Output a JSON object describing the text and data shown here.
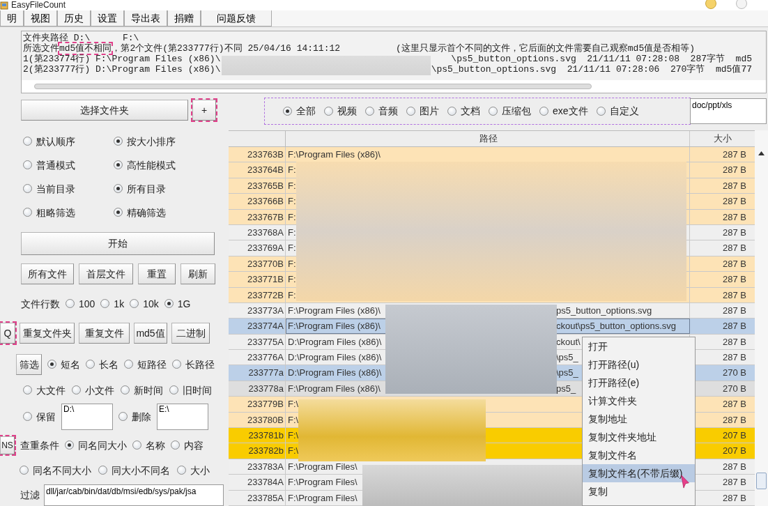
{
  "window": {
    "title": "EasyFileCount"
  },
  "menu": [
    "明",
    "视图",
    "历史",
    "设置",
    "导出表",
    "捐赠",
    "问题反馈"
  ],
  "log": {
    "folder_line": "文件夹路径 D:\\      F:\\",
    "summary_parts": [
      {
        "text": "所选文件",
        "highlighted": false
      },
      {
        "text": "md5值不相同",
        "highlighted": true
      },
      {
        "text": "，第2个文件(第233777行)不同 25/04/16 14:11:12",
        "highlighted": false
      }
    ],
    "note": "(这里只显示首个不同的文件，它后面的文件需要自己观察md5值是否相等)",
    "files": [
      {
        "head": "1(第233774行) F:\\Program Files (x86)\\",
        "tail": "\\ps5_button_options.svg  21/11/11 07:28:08  287字节  md5"
      },
      {
        "head": "2(第233777行) D:\\Program Files (x86)\\",
        "tail": "\\ps5_button_options.svg  21/11/11 07:28:06  270字节  md5值77"
      }
    ]
  },
  "select_folder_button": "选择文件夹",
  "add_button": {
    "label": "+",
    "highlighted": true
  },
  "option_pairs": [
    [
      {
        "label": "默认顺序",
        "selected": false
      },
      {
        "label": "按大小排序",
        "selected": true
      }
    ],
    [
      {
        "label": "普通模式",
        "selected": false
      },
      {
        "label": "高性能模式",
        "selected": true
      }
    ],
    [
      {
        "label": "当前目录",
        "selected": false
      },
      {
        "label": "所有目录",
        "selected": true
      }
    ],
    [
      {
        "label": "粗略筛选",
        "selected": false
      },
      {
        "label": "精确筛选",
        "selected": true
      }
    ]
  ],
  "start_button": "开始",
  "action_buttons": [
    "所有文件",
    "首层文件",
    "重置",
    "刷新"
  ],
  "row_count": {
    "label": "文件行数",
    "options": [
      {
        "label": "100",
        "selected": false
      },
      {
        "label": "1k",
        "selected": false
      },
      {
        "label": "10k",
        "selected": false
      },
      {
        "label": "1G",
        "selected": true
      }
    ]
  },
  "duplicate_buttons": [
    {
      "label": "Q",
      "highlighted": true
    },
    {
      "label": "重复文件夹",
      "highlighted": false
    },
    {
      "label": "重复文件",
      "highlighted": false
    },
    {
      "label": "md5值",
      "highlighted": false
    },
    {
      "label": "二进制",
      "highlighted": false
    }
  ],
  "filter_button": "筛选",
  "name_options": [
    {
      "label": "短名",
      "selected": true
    },
    {
      "label": "长名",
      "selected": false
    },
    {
      "label": "短路径",
      "selected": false
    },
    {
      "label": "长路径",
      "selected": false
    }
  ],
  "file_options": [
    {
      "label": "大文件",
      "selected": false
    },
    {
      "label": "小文件",
      "selected": false
    },
    {
      "label": "新时间",
      "selected": false
    },
    {
      "label": "旧时间",
      "selected": false
    }
  ],
  "keep": {
    "label": "保留",
    "selected": false,
    "value": "D:\\"
  },
  "delete": {
    "label": "删除",
    "selected": false,
    "value": "E:\\"
  },
  "ns_button": {
    "label": "NS",
    "highlighted": true
  },
  "criteria": {
    "label": "查重条件",
    "options": [
      {
        "label": "同名同大小",
        "selected": true
      },
      {
        "label": "名称",
        "selected": false
      },
      {
        "label": "内容",
        "selected": false
      }
    ],
    "more_options": [
      {
        "label": "同名不同大小",
        "selected": false
      },
      {
        "label": "同大小不同名",
        "selected": false
      },
      {
        "label": "大小",
        "selected": false
      }
    ]
  },
  "exclude": {
    "label": "过滤",
    "value": "dll/jar/cab/bin/dat/db/msi/edb/sys/pak/jsa"
  },
  "type_filter": {
    "highlighted": true,
    "options": [
      {
        "label": "全部",
        "selected": true
      },
      {
        "label": "视频",
        "selected": false
      },
      {
        "label": "音频",
        "selected": false
      },
      {
        "label": "图片",
        "selected": false
      },
      {
        "label": "文档",
        "selected": false
      },
      {
        "label": "压缩包",
        "selected": false
      },
      {
        "label": "exe文件",
        "selected": false
      },
      {
        "label": "自定义",
        "selected": false
      }
    ]
  },
  "custom_types": "doc/ppt/xls",
  "table": {
    "columns": [
      {
        "label": "路径"
      },
      {
        "label": "大小"
      }
    ],
    "rows": [
      {
        "id": "233763B",
        "path": "F:\\Program Files (x86)\\",
        "size": "287 B",
        "color": "#fde3b6",
        "selected": false
      },
      {
        "id": "233764B",
        "path": "F:",
        "size": "287 B",
        "color": "#fde3b6",
        "selected": false
      },
      {
        "id": "233765B",
        "path": "F:",
        "size": "287 B",
        "color": "#fde3b6",
        "selected": false
      },
      {
        "id": "233766B",
        "path": "F:",
        "size": "287 B",
        "color": "#fde3b6",
        "selected": false
      },
      {
        "id": "233767B",
        "path": "F:",
        "size": "287 B",
        "color": "#fde3b6",
        "selected": false
      },
      {
        "id": "233768A",
        "path": "F:",
        "size": "287 B",
        "color": "#efefef",
        "selected": false
      },
      {
        "id": "233769A",
        "path": "F:",
        "size": "287 B",
        "color": "#efefef",
        "selected": false
      },
      {
        "id": "233770B",
        "path": "F:",
        "size": "287 B",
        "color": "#fde3b6",
        "selected": false
      },
      {
        "id": "233771B",
        "path": "F:",
        "size": "287 B",
        "color": "#fde3b6",
        "selected": false
      },
      {
        "id": "233772B",
        "path": "F:",
        "size": "287 B",
        "color": "#fde3b6",
        "selected": false
      },
      {
        "id": "233773A",
        "path": "F:\\Program Files (x86)\\",
        "tail": "ps5_button_options.svg",
        "size": "287 B",
        "color": "#efefef",
        "selected": false
      },
      {
        "id": "233774A",
        "path": "F:\\Program Files (x86)\\",
        "tail": "ckout\\ps5_button_options.svg",
        "size": "287 B",
        "color": "#bcd0e8",
        "selected": true
      },
      {
        "id": "233775A",
        "path": "D:\\Program Files (x86)\\",
        "tail": "ckout\\",
        "size": "287 B",
        "color": "#efefef",
        "selected": false
      },
      {
        "id": "233776A",
        "path": "D:\\Program Files (x86)\\",
        "tail": "\\ps5_",
        "size": "287 B",
        "color": "#efefef",
        "selected": false
      },
      {
        "id": "233777a",
        "path": "D:\\Program Files (x86)\\",
        "tail": "\\ps5_",
        "size": "270 B",
        "color": "#bcd0e8",
        "selected": false
      },
      {
        "id": "233778a",
        "path": "F:\\Program Files (x86)\\",
        "tail": "ps5_",
        "size": "270 B",
        "color": "#dedede",
        "selected": false
      },
      {
        "id": "233779B",
        "path": "F:\\",
        "size": "287 B",
        "color": "#fde3b6",
        "selected": false
      },
      {
        "id": "233780B",
        "path": "F:\\",
        "size": "287 B",
        "color": "#fde3b6",
        "selected": false
      },
      {
        "id": "233781b",
        "path": "F:\\",
        "size": "207 B",
        "color": "#f9cc00",
        "selected": false
      },
      {
        "id": "233782b",
        "path": "F:\\",
        "size": "207 B",
        "color": "#f9cc00",
        "selected": false
      },
      {
        "id": "233783A",
        "path": "F:\\Program Files\\",
        "size": "287 B",
        "color": "#efefef",
        "selected": false
      },
      {
        "id": "233784A",
        "path": "F:\\Program Files\\",
        "size": "287 B",
        "color": "#efefef",
        "selected": false
      },
      {
        "id": "233785A",
        "path": "F:\\Program Files\\",
        "size": "287 B",
        "color": "#efefef",
        "selected": false
      }
    ]
  },
  "context_menu": [
    {
      "label": "打开",
      "selected": false
    },
    {
      "label": "打开路径(u)",
      "selected": false
    },
    {
      "label": "打开路径(e)",
      "selected": false
    },
    {
      "label": "计算文件夹",
      "selected": false
    },
    {
      "label": "复制地址",
      "selected": false
    },
    {
      "label": "复制文件夹地址",
      "selected": false
    },
    {
      "label": "复制文件名",
      "selected": false
    },
    {
      "label": "复制文件名(不带后缀)",
      "selected": true
    },
    {
      "label": "复制",
      "selected": false
    }
  ]
}
